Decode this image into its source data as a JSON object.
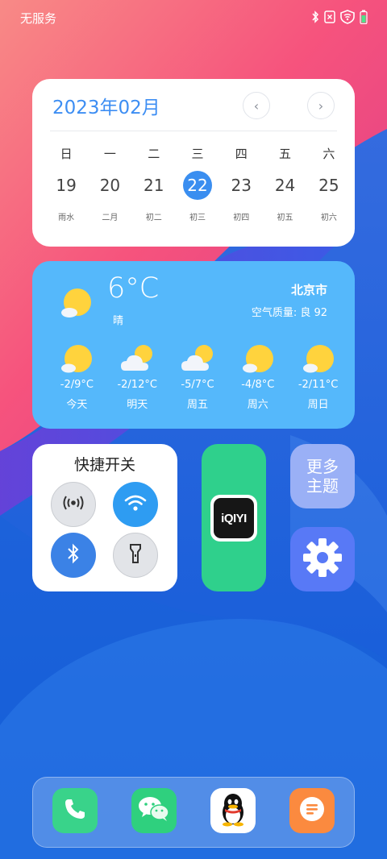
{
  "status_bar": {
    "carrier": "无服务",
    "icons": [
      "bluetooth-icon",
      "no-sim-icon",
      "wifi-icon",
      "battery-icon"
    ]
  },
  "calendar": {
    "title": "2023年02月",
    "prev_label": "‹",
    "next_label": "›",
    "weekdays": [
      "日",
      "一",
      "二",
      "三",
      "四",
      "五",
      "六"
    ],
    "dates": [
      "19",
      "20",
      "21",
      "22",
      "23",
      "24",
      "25"
    ],
    "lunar": [
      "雨水",
      "二月",
      "初二",
      "初三",
      "初四",
      "初五",
      "初六"
    ],
    "today_date": "22",
    "accent_color": "#3a8ef0"
  },
  "weather": {
    "temperature": "6°C",
    "condition": "晴",
    "city": "北京市",
    "air_quality": "空气质量: 良 92",
    "forecast": [
      {
        "range": "-2/9°C",
        "day": "今天",
        "icon": "sunny-cloud-icon"
      },
      {
        "range": "-2/12°C",
        "day": "明天",
        "icon": "cloudy-sun-icon"
      },
      {
        "range": "-5/7°C",
        "day": "周五",
        "icon": "cloudy-sun-icon"
      },
      {
        "range": "-4/8°C",
        "day": "周六",
        "icon": "sunny-cloud-icon"
      },
      {
        "range": "-2/11°C",
        "day": "周日",
        "icon": "sunny-cloud-icon"
      }
    ]
  },
  "quick_toggles": {
    "title": "快捷开关",
    "items": [
      {
        "name": "hotspot",
        "icon": "hotspot-icon",
        "active": false
      },
      {
        "name": "wifi",
        "icon": "wifi-icon",
        "active": true
      },
      {
        "name": "bluetooth",
        "icon": "bluetooth-icon",
        "active": true
      },
      {
        "name": "flashlight",
        "icon": "flashlight-icon",
        "active": false
      }
    ]
  },
  "iqiyi": {
    "logo_text": "iQIYI"
  },
  "more_themes": {
    "line1": "更多",
    "line2": "主题"
  },
  "dock": {
    "apps": [
      "phone-icon",
      "wechat-icon",
      "qq-icon",
      "notes-icon"
    ]
  }
}
